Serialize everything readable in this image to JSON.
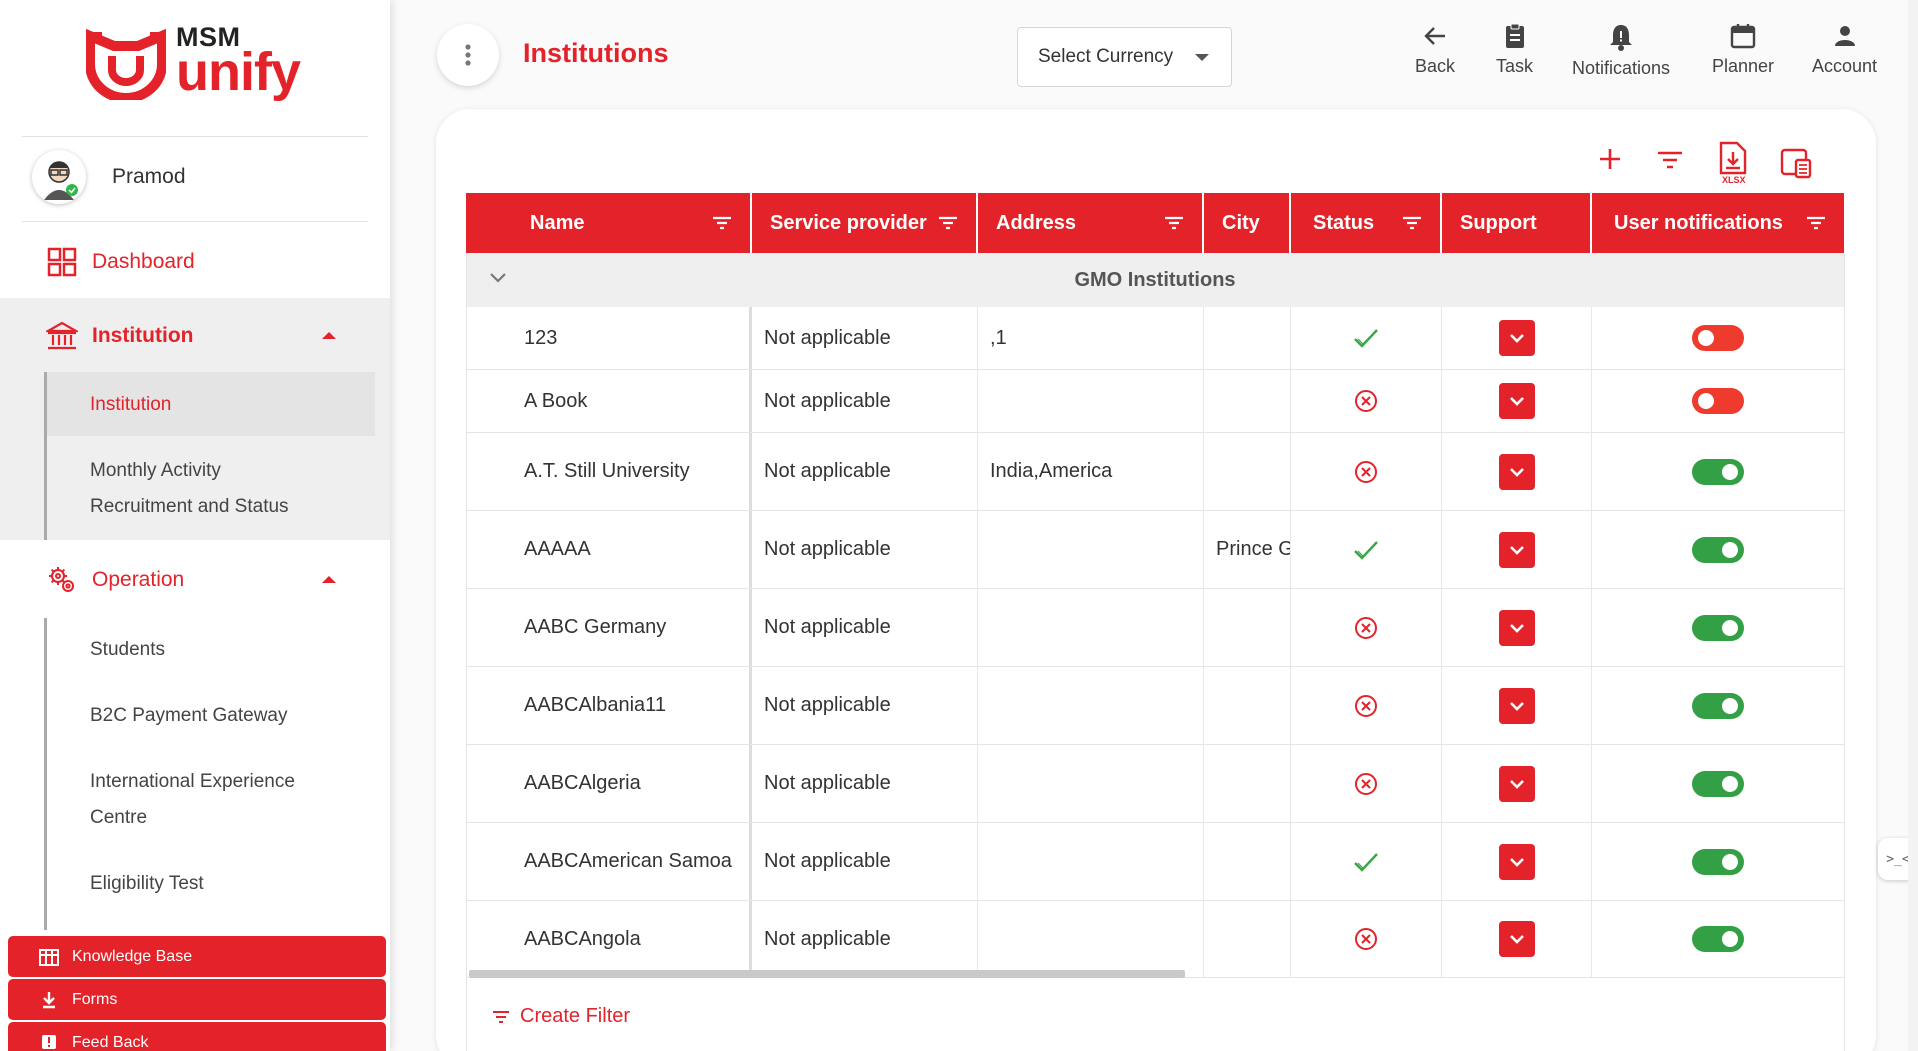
{
  "brand": {
    "msm": "MSM",
    "unify": "unify",
    "color": "#e3222a"
  },
  "user": {
    "name": "Pramod"
  },
  "sidebar": {
    "dashboard": "Dashboard",
    "institution": {
      "label": "Institution",
      "children": [
        "Institution",
        "Monthly Activity Recruitment and Status"
      ],
      "child_2_lines": [
        "Monthly Activity",
        "Recruitment and Status"
      ]
    },
    "operation": {
      "label": "Operation",
      "children": [
        "Students",
        "B2C Payment Gateway",
        "International Experience Centre",
        "Eligibility Test"
      ],
      "child_3_lines": [
        "International Experience",
        "Centre"
      ]
    },
    "buttons": [
      "Knowledge Base",
      "Forms",
      "Feed Back"
    ]
  },
  "header": {
    "title": "Institutions",
    "currency_placeholder": "Select Currency",
    "actions": [
      "Back",
      "Task",
      "Notifications",
      "Planner",
      "Account"
    ]
  },
  "toolbar": {
    "xlsx_label": "XLSX"
  },
  "table": {
    "columns": [
      "Name",
      "Service provider",
      "Address",
      "City",
      "Status",
      "Support",
      "User notifications"
    ],
    "group": "GMO Institutions",
    "rows": [
      {
        "name": "123",
        "provider": "Not applicable",
        "address": ",1",
        "city": "",
        "status": "active",
        "notifications": false
      },
      {
        "name": "A Book",
        "provider": "Not applicable",
        "address": "",
        "city": "",
        "status": "inactive",
        "notifications": false
      },
      {
        "name": "A.T. Still University",
        "provider": "Not applicable",
        "address": "India,America",
        "city": "",
        "status": "inactive",
        "notifications": true
      },
      {
        "name": "AAAAA",
        "provider": "Not applicable",
        "address": "",
        "city": "Prince G",
        "status": "active",
        "notifications": true
      },
      {
        "name": "AABC Germany",
        "provider": "Not applicable",
        "address": "",
        "city": "",
        "status": "inactive",
        "notifications": true
      },
      {
        "name": "AABCAlbania11",
        "provider": "Not applicable",
        "address": "",
        "city": "",
        "status": "inactive",
        "notifications": true
      },
      {
        "name": "AABCAlgeria",
        "provider": "Not applicable",
        "address": "",
        "city": "",
        "status": "inactive",
        "notifications": true
      },
      {
        "name": "AABCAmerican Samoa",
        "provider": "Not applicable",
        "address": "",
        "city": "",
        "status": "active",
        "notifications": true
      },
      {
        "name": "AABCAngola",
        "provider": "Not applicable",
        "address": "",
        "city": "",
        "status": "inactive",
        "notifications": true
      }
    ]
  },
  "footer": {
    "create_filter": "Create Filter"
  },
  "side_tab": {
    "label": ">_<"
  }
}
